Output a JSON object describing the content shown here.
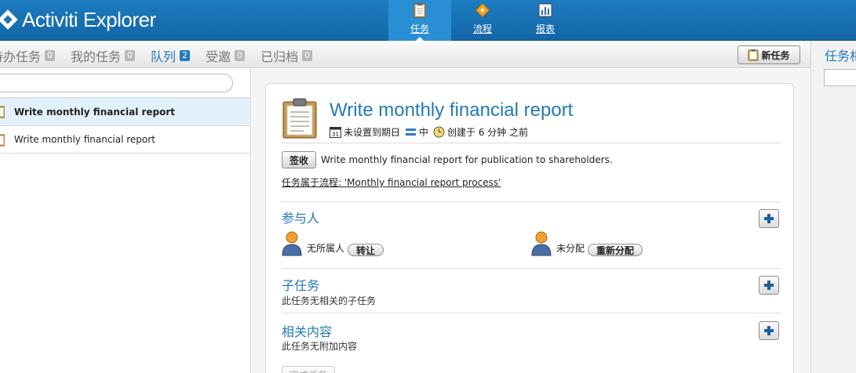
{
  "app": {
    "title": "Activiti Explorer"
  },
  "nav": [
    {
      "label": "任务",
      "icon": "clipboard-icon",
      "active": true
    },
    {
      "label": "流程",
      "icon": "process-icon",
      "active": false
    },
    {
      "label": "报表",
      "icon": "bar-chart-icon",
      "active": false
    }
  ],
  "tabs": [
    {
      "label": "待办任务",
      "count": "0"
    },
    {
      "label": "我的任务",
      "count": "0"
    },
    {
      "label": "队列",
      "count": "2",
      "active": true
    },
    {
      "label": "受邀",
      "count": "0"
    },
    {
      "label": "已归档",
      "count": "0"
    }
  ],
  "toolbar": {
    "new_task_label": "新任务"
  },
  "right_panel": {
    "title": "任务相"
  },
  "search": {
    "value": ""
  },
  "task_list": [
    {
      "name": "Write monthly financial report",
      "selected": true
    },
    {
      "name": "Write monthly financial report",
      "selected": false
    }
  ],
  "task": {
    "title": "Write monthly financial report",
    "due": "未设置到期日",
    "priority": "中",
    "created": "创建于 6 分钟 之前",
    "claim_label": "签收",
    "description": "Write monthly financial report for publication to shareholders.",
    "process_link": "任务属于流程: 'Monthly financial report process'",
    "people": {
      "title": "参与人",
      "owner_label": "无所属人",
      "owner_action": "转让",
      "assignee_label": "未分配",
      "assignee_action": "重新分配"
    },
    "subtasks": {
      "title": "子任务",
      "empty": "此任务无相关的子任务"
    },
    "related": {
      "title": "相关内容",
      "empty": "此任务无附加内容"
    },
    "complete_label": "完成任务"
  },
  "colors": {
    "header": "#1d7cc0",
    "accent": "#2479b9",
    "selected_row": "#e3f1fc"
  }
}
